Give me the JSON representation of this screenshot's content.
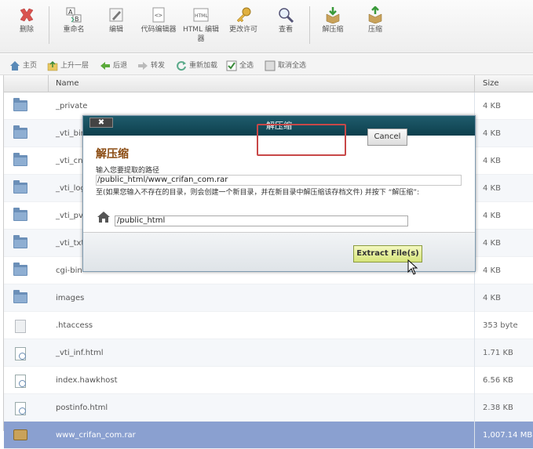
{
  "toolbar": {
    "items": [
      {
        "label": "删除",
        "icon": "delete-icon"
      },
      {
        "label": "重命名",
        "icon": "rename-icon"
      },
      {
        "label": "编辑",
        "icon": "edit-icon"
      },
      {
        "label": "代码编辑器",
        "icon": "code-editor-icon"
      },
      {
        "label": "HTML 编辑器",
        "icon": "html-editor-icon"
      },
      {
        "label": "更改许可",
        "icon": "key-icon"
      },
      {
        "label": "查看",
        "icon": "magnifier-icon"
      },
      {
        "label": "解压缩",
        "icon": "extract-icon"
      },
      {
        "label": "压缩",
        "icon": "compress-icon"
      }
    ]
  },
  "nav": {
    "items": [
      {
        "label": "主页",
        "icon": "home-icon"
      },
      {
        "label": "上升一层",
        "icon": "up-folder-icon"
      },
      {
        "label": "后退",
        "icon": "back-arrow-icon"
      },
      {
        "label": "转发",
        "icon": "forward-arrow-icon"
      },
      {
        "label": "重新加载",
        "icon": "reload-icon"
      },
      {
        "label": "全选",
        "icon": "checkbox-checked-icon"
      },
      {
        "label": "取消全选",
        "icon": "checkbox-empty-icon"
      }
    ]
  },
  "table": {
    "col_name": "Name",
    "col_size": "Size",
    "rows": [
      {
        "name": "_private",
        "size": "4 KB",
        "type": "folder"
      },
      {
        "name": "_vti_bin",
        "size": "4 KB",
        "type": "folder"
      },
      {
        "name": "_vti_cn",
        "size": "4 KB",
        "type": "folder"
      },
      {
        "name": "_vti_log",
        "size": "4 KB",
        "type": "folder"
      },
      {
        "name": "_vti_pvt",
        "size": "4 KB",
        "type": "folder"
      },
      {
        "name": "_vti_txt",
        "size": "4 KB",
        "type": "folder"
      },
      {
        "name": "cgi-bin",
        "size": "4 KB",
        "type": "folder"
      },
      {
        "name": "images",
        "size": "4 KB",
        "type": "folder"
      },
      {
        "name": ".htaccess",
        "size": "353 byte",
        "type": "doc"
      },
      {
        "name": "_vti_inf.html",
        "size": "1.71 KB",
        "type": "html"
      },
      {
        "name": "index.hawkhost",
        "size": "6.56 KB",
        "type": "html"
      },
      {
        "name": "postinfo.html",
        "size": "2.38 KB",
        "type": "html"
      },
      {
        "name": "www_crifan_com.rar",
        "size": "1,007.14 MB",
        "type": "rar"
      }
    ]
  },
  "dialog": {
    "title": "解压缩",
    "close_label": "✖",
    "heading": "解压缩",
    "path_prompt": "输入您要提取的路径",
    "archive_path": "/public_html/www_crifan_com.rar",
    "note": "至(如果您输入不存在的目录，则会创建一个新目录，并在新目录中解压缩该存档文件) 并按下 “解压缩”:",
    "destination": "/public_html",
    "extract_label": "Extract File(s)",
    "cancel_label": "Cancel"
  }
}
